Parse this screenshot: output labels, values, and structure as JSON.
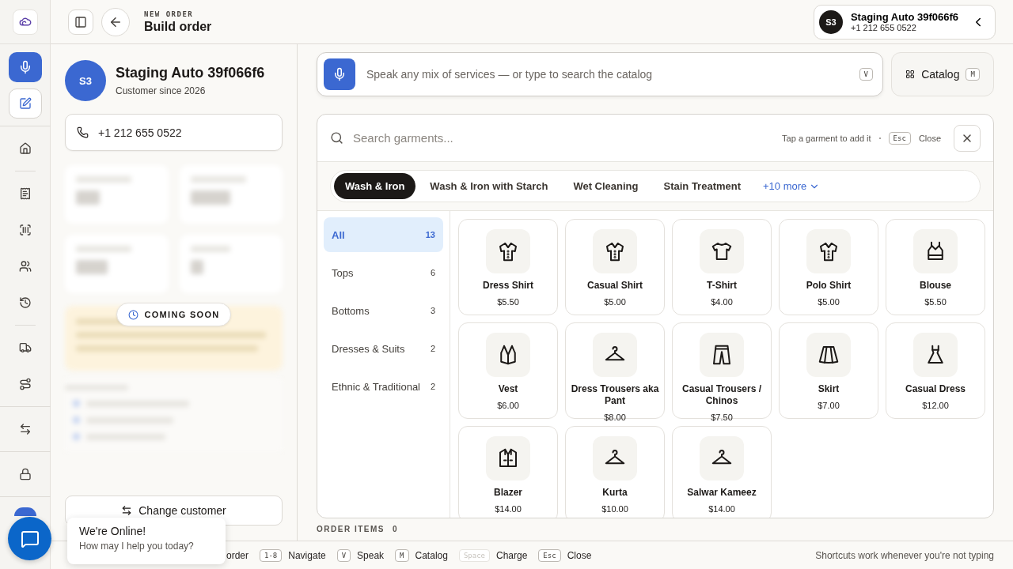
{
  "header": {
    "eyebrow": "NEW ORDER",
    "title": "Build order"
  },
  "customer_chip": {
    "initials": "S3",
    "name": "Staging Auto 39f066f6",
    "phone": "+1 212 655 0522"
  },
  "customer": {
    "initials": "S3",
    "name": "Staging Auto 39f066f6",
    "since": "Customer since 2026",
    "phone": "+1 212 655 0522",
    "badge": "COMING SOON",
    "change_button": "Change customer"
  },
  "rail": [
    {
      "kind": "mic",
      "selected": true
    },
    {
      "kind": "edit",
      "selected": false
    },
    {
      "kind": "divider"
    },
    {
      "kind": "home",
      "selected": false
    },
    {
      "kind": "divider"
    },
    {
      "kind": "receipt",
      "selected": false
    },
    {
      "kind": "barcode",
      "selected": false
    },
    {
      "kind": "users",
      "selected": false
    },
    {
      "kind": "history",
      "selected": false
    },
    {
      "kind": "divider"
    },
    {
      "kind": "truck",
      "selected": false
    },
    {
      "kind": "route",
      "selected": false
    },
    {
      "kind": "divider"
    },
    {
      "kind": "swap",
      "selected": false
    },
    {
      "kind": "divider"
    },
    {
      "kind": "lock",
      "selected": false
    }
  ],
  "voice": {
    "placeholder": "Speak any mix of services — or type to search the catalog",
    "key": "V"
  },
  "catalog_button": {
    "label": "Catalog",
    "key": "M"
  },
  "catalog": {
    "search_placeholder": "Search garments...",
    "hint": "Tap a garment to add it",
    "close_key": "Esc",
    "close_label": "Close",
    "services": [
      {
        "label": "Wash & Iron",
        "selected": true
      },
      {
        "label": "Wash & Iron with Starch",
        "selected": false
      },
      {
        "label": "Wet Cleaning",
        "selected": false
      },
      {
        "label": "Stain Treatment",
        "selected": false
      }
    ],
    "more": "+10 more",
    "categories": [
      {
        "label": "All",
        "count": "13",
        "selected": true
      },
      {
        "label": "Tops",
        "count": "6",
        "selected": false
      },
      {
        "label": "Bottoms",
        "count": "3",
        "selected": false
      },
      {
        "label": "Dresses & Suits",
        "count": "2",
        "selected": false
      },
      {
        "label": "Ethnic & Traditional",
        "count": "2",
        "selected": false
      }
    ],
    "garments": [
      {
        "kind": "shirt",
        "name": "Dress Shirt",
        "price": "$5.50"
      },
      {
        "kind": "shirt",
        "name": "Casual Shirt",
        "price": "$5.00"
      },
      {
        "kind": "tshirt",
        "name": "T-Shirt",
        "price": "$4.00"
      },
      {
        "kind": "shirt",
        "name": "Polo Shirt",
        "price": "$5.00"
      },
      {
        "kind": "tank",
        "name": "Blouse",
        "price": "$5.50"
      },
      {
        "kind": "vest",
        "name": "Vest",
        "price": "$6.00"
      },
      {
        "kind": "hanger",
        "name": "Dress Trousers aka Pant",
        "price": "$8.00"
      },
      {
        "kind": "trousers",
        "name": "Casual Trousers / Chinos",
        "price": "$7.50"
      },
      {
        "kind": "skirt",
        "name": "Skirt",
        "price": "$7.00"
      },
      {
        "kind": "dress",
        "name": "Casual Dress",
        "price": "$12.00"
      },
      {
        "kind": "jacket",
        "name": "Blazer",
        "price": "$14.00"
      },
      {
        "kind": "hanger",
        "name": "Kurta",
        "price": "$10.00"
      },
      {
        "kind": "hanger",
        "name": "Salwar Kameez",
        "price": "$14.00"
      }
    ]
  },
  "order_items": {
    "label": "ORDER ITEMS",
    "count": "0"
  },
  "shortcuts": [
    {
      "label": "order"
    },
    {
      "key": "1-8",
      "label": "Navigate"
    },
    {
      "key": "V",
      "label": "Speak"
    },
    {
      "key": "M",
      "label": "Catalog"
    },
    {
      "key": "Space",
      "label": "Charge",
      "disabled": true
    },
    {
      "key": "Esc",
      "label": "Close"
    }
  ],
  "shortcut_note": "Shortcuts work whenever you're not typing",
  "chat": {
    "title": "We're Online!",
    "subtitle": "How may I help you today?"
  }
}
